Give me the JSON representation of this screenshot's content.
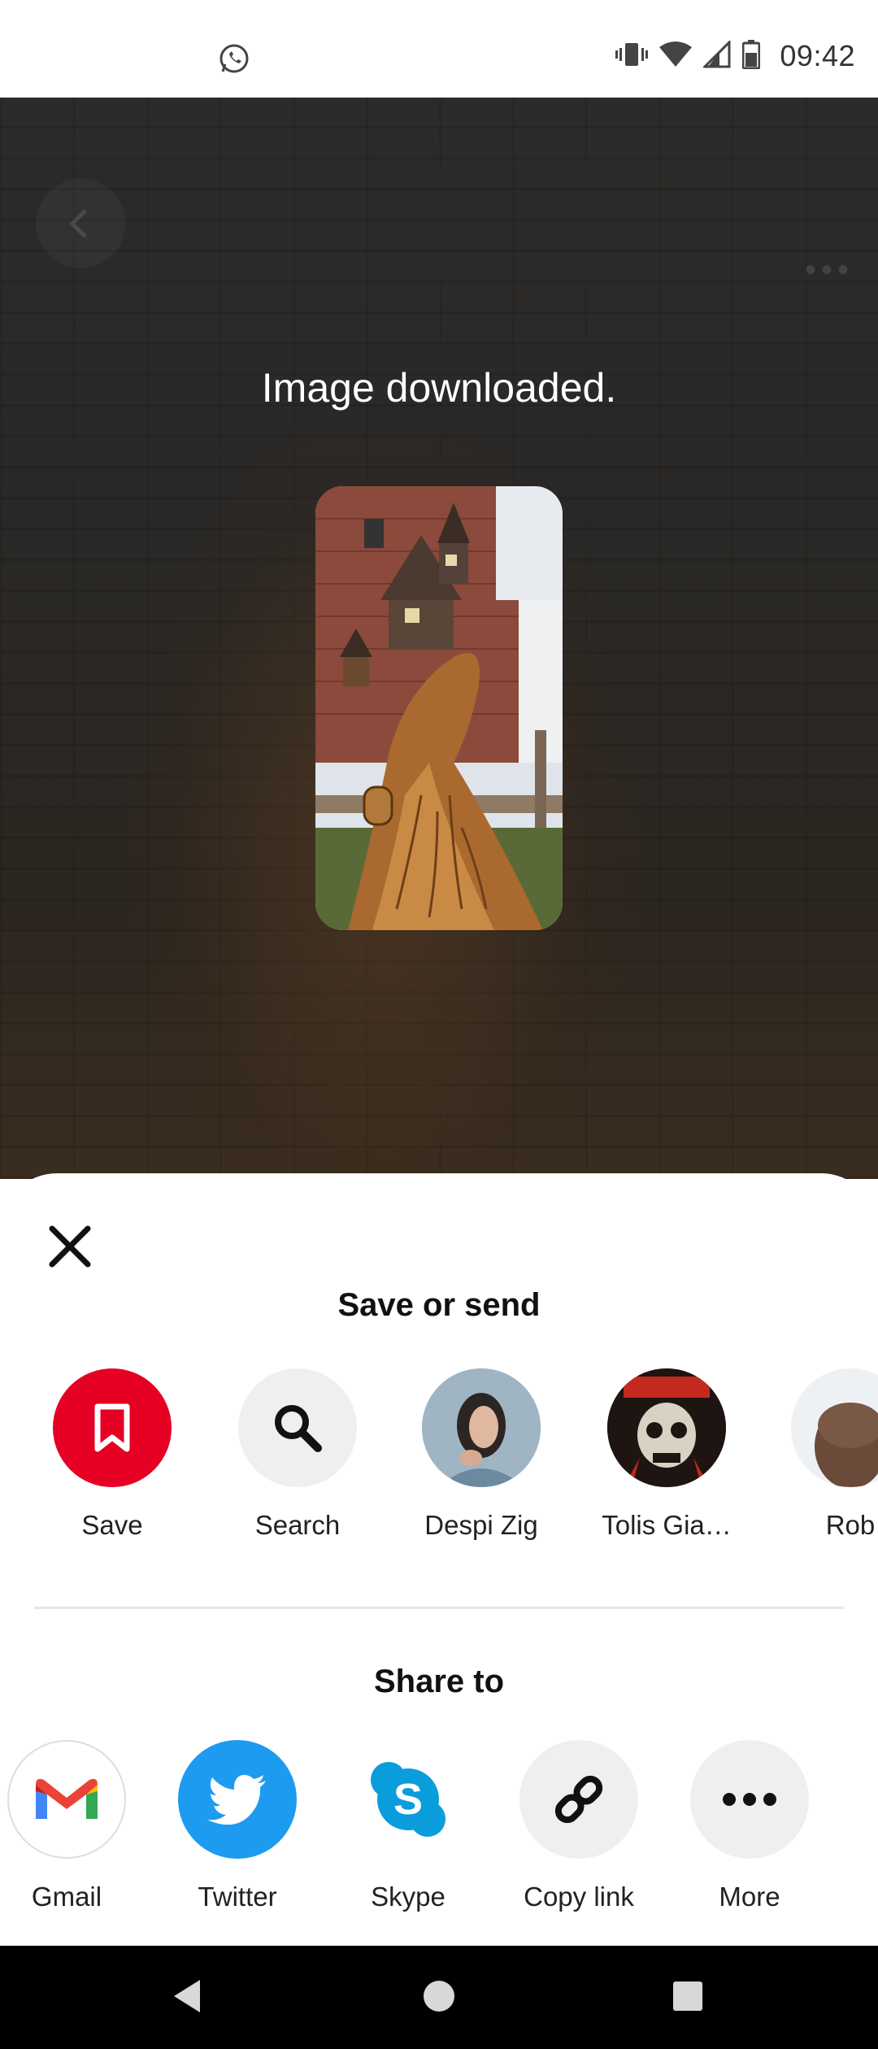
{
  "status_bar": {
    "time": "09:42",
    "icons": [
      "whatsapp-icon",
      "vibrate-icon",
      "wifi-icon",
      "signal-icon",
      "battery-icon"
    ]
  },
  "overlay": {
    "message": "Image downloaded."
  },
  "sheet": {
    "title": "Save or send",
    "send_items": [
      {
        "label": "Save",
        "icon": "bookmark-icon",
        "color": "#e60023"
      },
      {
        "label": "Search",
        "icon": "search-icon",
        "color": "#efefef"
      },
      {
        "label": "Despi Zig",
        "icon": "avatar"
      },
      {
        "label": "Tolis Gia…",
        "icon": "avatar"
      },
      {
        "label": "Rob",
        "icon": "avatar"
      }
    ],
    "share_title": "Share to",
    "share_items": [
      {
        "label": "Gmail",
        "icon": "gmail-icon"
      },
      {
        "label": "Twitter",
        "icon": "twitter-icon",
        "color": "#1d9bf0"
      },
      {
        "label": "Skype",
        "icon": "skype-icon",
        "color": "#0a9ddb"
      },
      {
        "label": "Copy link",
        "icon": "link-icon"
      },
      {
        "label": "More",
        "icon": "more-icon"
      }
    ]
  },
  "colors": {
    "save_red": "#e60023",
    "twitter_blue": "#1d9bf0",
    "skype_blue": "#0a9ddb",
    "light_gray": "#efefef"
  }
}
